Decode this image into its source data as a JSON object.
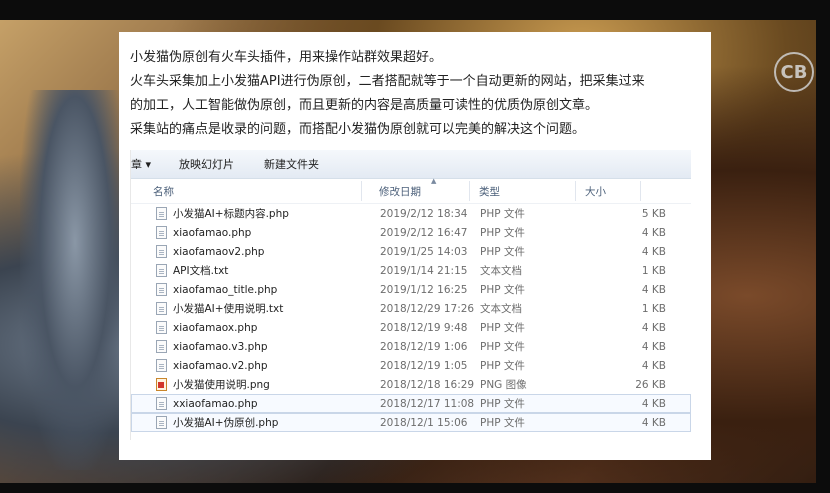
{
  "brand": {
    "logo_text": "CB"
  },
  "article": {
    "lines": [
      "小发猫伪原创有火车头插件，用来操作站群效果超好。",
      "火车头采集加上小发猫API进行伪原创，二者搭配就等于一个自动更新的网站，把采集过来",
      "的加工，人工智能做伪原创，而且更新的内容是高质量可读性的优质伪原创文章。",
      "采集站的痛点是收录的问题，而搭配小发猫伪原创就可以完美的解决这个问题。"
    ]
  },
  "explorer": {
    "toolbar": {
      "organize": "章 ▾",
      "slideshow": "放映幻灯片",
      "new_folder": "新建文件夹"
    },
    "columns": {
      "name": "名称",
      "date": "修改日期",
      "type": "类型",
      "size": "大小"
    },
    "files": [
      {
        "name": "小发猫AI+标题内容.php",
        "date": "2019/2/12 18:34",
        "type": "PHP 文件",
        "size": "5 KB",
        "icon": "php-file-icon"
      },
      {
        "name": "xiaofamao.php",
        "date": "2019/2/12 16:47",
        "type": "PHP 文件",
        "size": "4 KB",
        "icon": "php-file-icon"
      },
      {
        "name": "xiaofamaov2.php",
        "date": "2019/1/25 14:03",
        "type": "PHP 文件",
        "size": "4 KB",
        "icon": "php-file-icon"
      },
      {
        "name": "API文档.txt",
        "date": "2019/1/14 21:15",
        "type": "文本文档",
        "size": "1 KB",
        "icon": "text-file-icon"
      },
      {
        "name": "xiaofamao_title.php",
        "date": "2019/1/12 16:25",
        "type": "PHP 文件",
        "size": "4 KB",
        "icon": "php-file-icon"
      },
      {
        "name": "小发猫AI+使用说明.txt",
        "date": "2018/12/29 17:26",
        "type": "文本文档",
        "size": "1 KB",
        "icon": "text-file-icon"
      },
      {
        "name": "xiaofamaox.php",
        "date": "2018/12/19 9:48",
        "type": "PHP 文件",
        "size": "4 KB",
        "icon": "php-file-icon"
      },
      {
        "name": "xiaofamao.v3.php",
        "date": "2018/12/19 1:06",
        "type": "PHP 文件",
        "size": "4 KB",
        "icon": "php-file-icon"
      },
      {
        "name": "xiaofamao.v2.php",
        "date": "2018/12/19 1:05",
        "type": "PHP 文件",
        "size": "4 KB",
        "icon": "php-file-icon"
      },
      {
        "name": "小发猫使用说明.png",
        "date": "2018/12/18 16:29",
        "type": "PNG 图像",
        "size": "26 KB",
        "icon": "png-image-icon"
      },
      {
        "name": "xxiaofamao.php",
        "date": "2018/12/17 11:08",
        "type": "PHP 文件",
        "size": "4 KB",
        "icon": "php-file-icon",
        "selected": true
      },
      {
        "name": "小发猫AI+伪原创.php",
        "date": "2018/12/1 15:06",
        "type": "PHP 文件",
        "size": "4 KB",
        "icon": "php-file-icon",
        "selected": true
      }
    ]
  }
}
